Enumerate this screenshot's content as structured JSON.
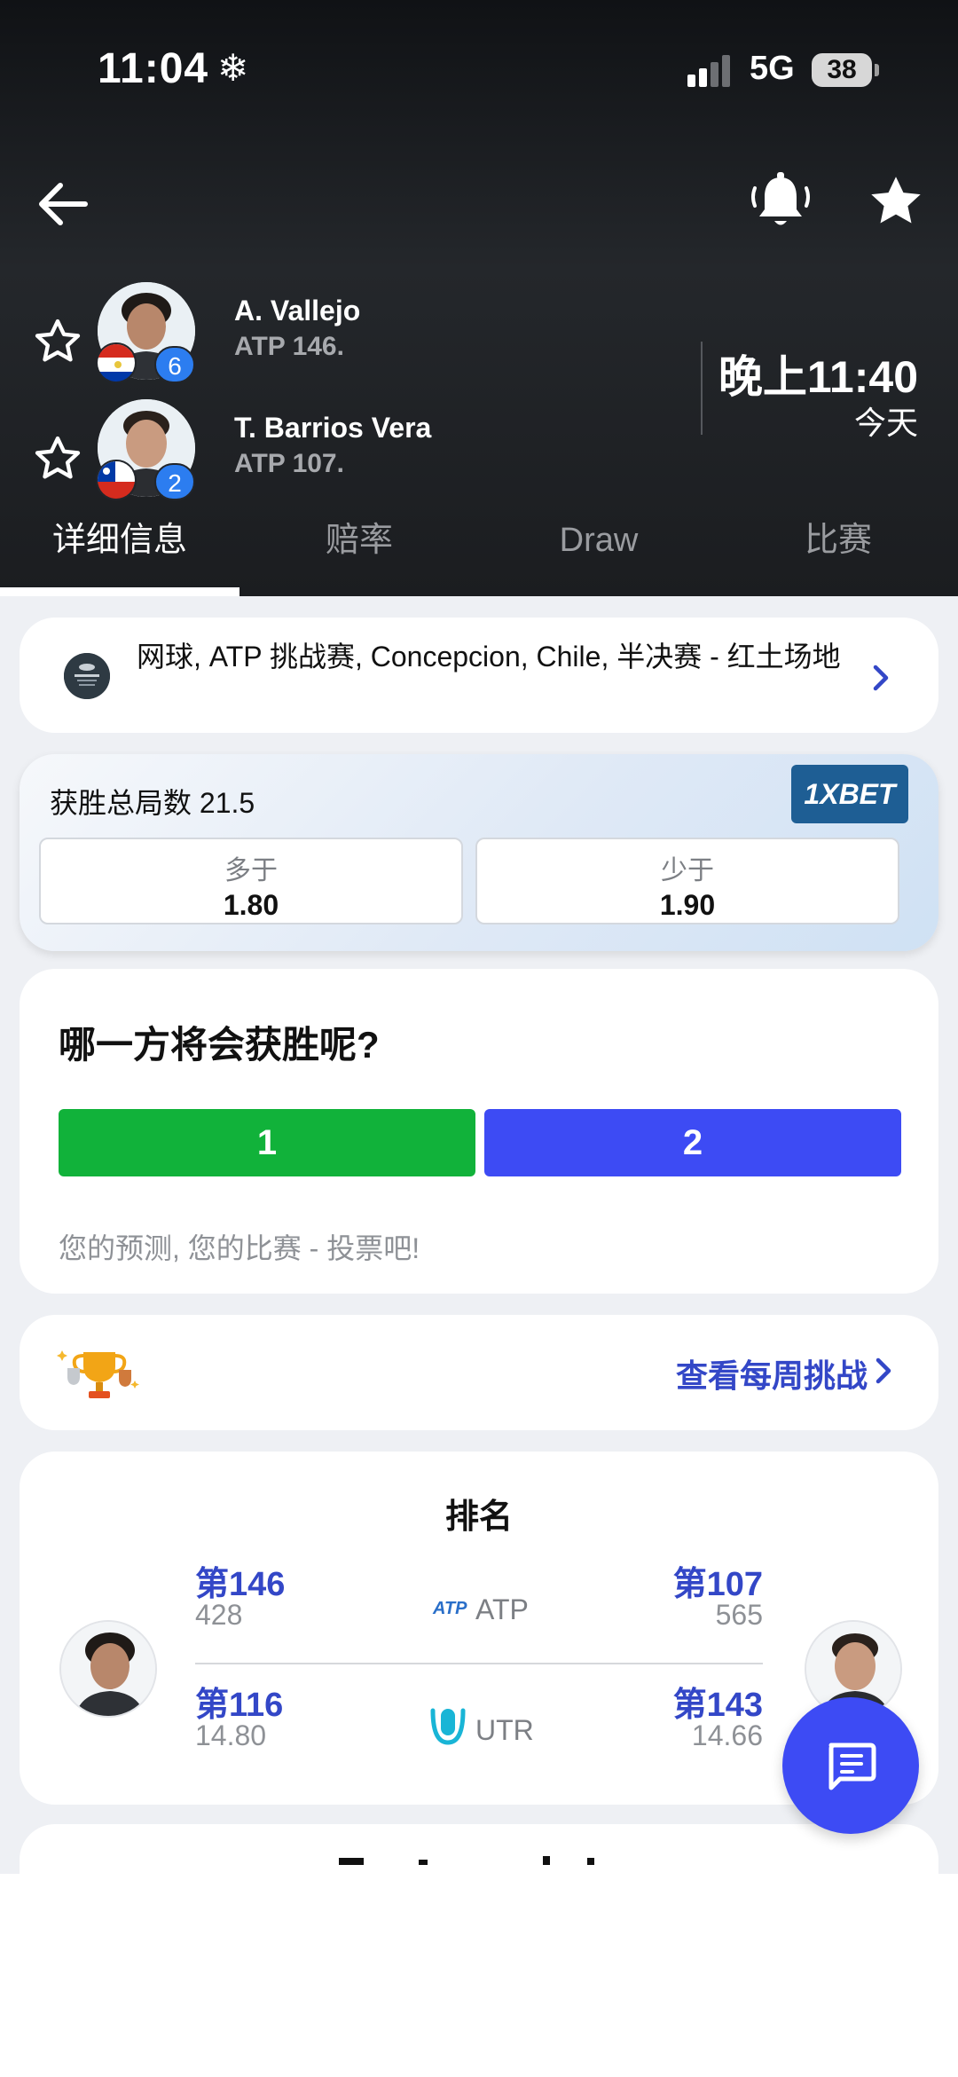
{
  "status_bar": {
    "time": "11:04",
    "network": "5G",
    "battery": "38"
  },
  "players": [
    {
      "name": "A. Vallejo",
      "rank": "ATP 146.",
      "seed": "6",
      "flag": "paraguay-flag"
    },
    {
      "name": "T. Barrios Vera",
      "rank": "ATP 107.",
      "seed": "2",
      "flag": "chile-flag"
    }
  ],
  "match": {
    "time": "晚上11:40",
    "day": "今天"
  },
  "tabs": [
    {
      "label": "详细信息",
      "active": true
    },
    {
      "label": "赔率",
      "active": false
    },
    {
      "label": "Draw",
      "active": false
    },
    {
      "label": "比赛",
      "active": false
    }
  ],
  "tournament": {
    "text": "网球, ATP 挑战赛, Concepcion, Chile, 半决赛 - 红土场地"
  },
  "odds": {
    "label": "获胜总局数 21.5",
    "bookmaker": "1XBET",
    "over": {
      "label": "多于",
      "value": "1.80"
    },
    "under": {
      "label": "少于",
      "value": "1.90"
    }
  },
  "prediction": {
    "question": "哪一方将会获胜呢?",
    "option1": "1",
    "option2": "2",
    "hint": "您的预测, 您的比赛 - 投票吧!"
  },
  "challenge": {
    "link": "查看每周挑战"
  },
  "ranking": {
    "title": "排名",
    "rows": [
      {
        "org": "ATP",
        "left_rank": "第146",
        "left_value": "428",
        "right_rank": "第107",
        "right_value": "565"
      },
      {
        "org": "UTR",
        "left_rank": "第116",
        "left_value": "14.80",
        "right_rank": "第143",
        "right_value": "14.66"
      }
    ]
  },
  "colors": {
    "accent": "#3d4bf4",
    "green": "#11b23a",
    "link": "#3347c7",
    "header": "#1b1d20"
  }
}
